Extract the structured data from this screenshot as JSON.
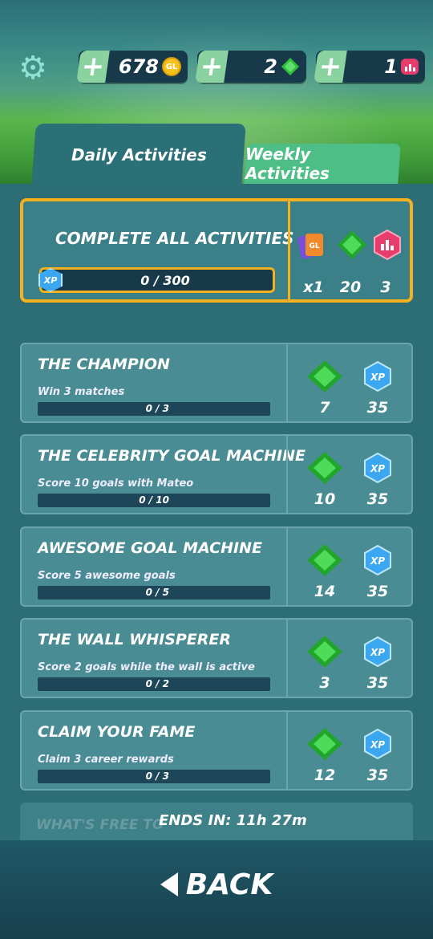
{
  "currencies": [
    {
      "value": "678",
      "icon": "coin-icon",
      "icon_text": "GL"
    },
    {
      "value": "2",
      "icon": "gem-icon"
    },
    {
      "value": "1",
      "icon": "trophy-badge-icon"
    }
  ],
  "tabs": {
    "daily": "Daily Activities",
    "weekly": "Weekly Activities"
  },
  "complete_all": {
    "title": "COMPLETE ALL ACTIVITIES",
    "progress": "0 / 300",
    "xp_label": "XP",
    "rewards": [
      {
        "icon": "cards-icon",
        "value": "x1"
      },
      {
        "icon": "gem-icon",
        "value": "20"
      },
      {
        "icon": "trophy-badge-icon",
        "value": "3"
      }
    ]
  },
  "activities": [
    {
      "title": "THE CHAMPION",
      "desc": "Win 3 matches",
      "progress": "0 / 3",
      "gems": "7",
      "xp": "35"
    },
    {
      "title": "THE CELEBRITY GOAL MACHINE",
      "desc": "Score 10 goals with Mateo",
      "progress": "0 / 10",
      "gems": "10",
      "xp": "35"
    },
    {
      "title": "AWESOME GOAL MACHINE",
      "desc": "Score 5 awesome goals",
      "progress": "0 / 5",
      "gems": "14",
      "xp": "35"
    },
    {
      "title": "THE WALL WHISPERER",
      "desc": "Score 2 goals while the wall is active",
      "progress": "0 / 2",
      "gems": "3",
      "xp": "35"
    },
    {
      "title": "CLAIM YOUR FAME",
      "desc": "Claim 3 career rewards",
      "progress": "0 / 3",
      "gems": "12",
      "xp": "35"
    }
  ],
  "partial_item": "WHAT'S FREE TO",
  "ends_in": "ENDS IN: 11h 27m",
  "back": "BACK",
  "colors": {
    "accent": "#f5b21c",
    "gem": "#2fbf3a",
    "xp": "#3aa7f0",
    "badge": "#e63d6d"
  }
}
